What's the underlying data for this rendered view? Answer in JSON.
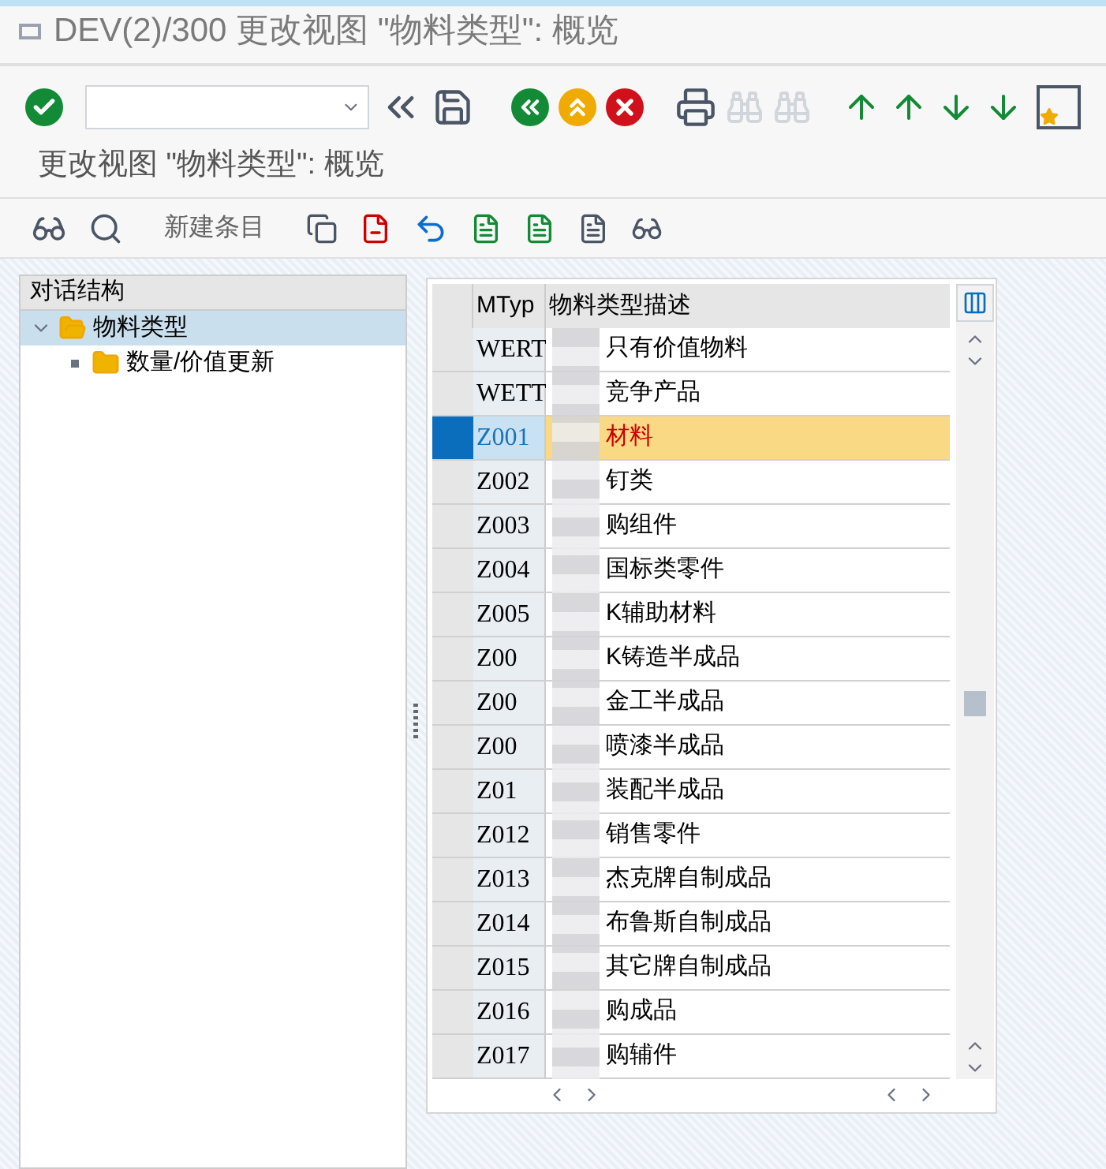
{
  "window": {
    "title": "DEV(2)/300 更改视图 \"物料类型\": 概览"
  },
  "screen_title": "更改视图 \"物料类型\": 概览",
  "app_toolbar": {
    "new_entries": "新建条目"
  },
  "tree": {
    "header": "对话结构",
    "items": [
      {
        "label": "物料类型",
        "selected": true,
        "expanded": true,
        "children": [
          {
            "label": "数量/价值更新",
            "selected": false
          }
        ]
      }
    ]
  },
  "table": {
    "columns": [
      "MTyp",
      "物料类型描述"
    ],
    "rows": [
      {
        "code": "WERT",
        "description": "只有价值物料",
        "selected": false
      },
      {
        "code": "WETT",
        "description": "竞争产品",
        "selected": false
      },
      {
        "code": "Z001",
        "description": "材料",
        "selected": true
      },
      {
        "code": "Z002",
        "description": "钉类",
        "selected": false
      },
      {
        "code": "Z003",
        "description": "购组件",
        "selected": false
      },
      {
        "code": "Z004",
        "description": "国标类零件",
        "selected": false
      },
      {
        "code": "Z005",
        "description": "K辅助材料",
        "selected": false
      },
      {
        "code": "Z00",
        "description": "K铸造半成品",
        "selected": false
      },
      {
        "code": "Z00",
        "description": "金工半成品",
        "selected": false
      },
      {
        "code": "Z00",
        "description": "喷漆半成品",
        "selected": false
      },
      {
        "code": "Z01",
        "description": "装配半成品",
        "selected": false
      },
      {
        "code": "Z012",
        "description": "销售零件",
        "selected": false
      },
      {
        "code": "Z013",
        "description": "杰克牌自制成品",
        "selected": false
      },
      {
        "code": "Z014",
        "description": "布鲁斯自制成品",
        "selected": false
      },
      {
        "code": "Z015",
        "description": "其它牌自制成品",
        "selected": false
      },
      {
        "code": "Z016",
        "description": "购成品",
        "selected": false
      },
      {
        "code": "Z017",
        "description": "购辅件",
        "selected": false
      }
    ]
  }
}
